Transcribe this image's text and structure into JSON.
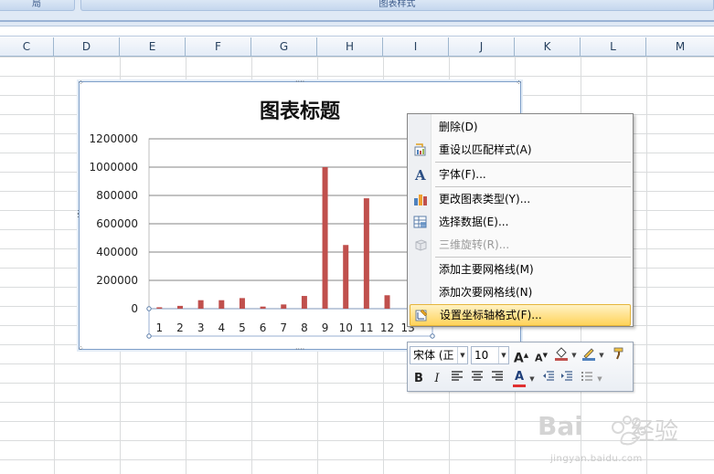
{
  "ribbon": {
    "left_group_label": "局",
    "right_group_label": "图表样式"
  },
  "columns": [
    "C",
    "D",
    "E",
    "F",
    "G",
    "H",
    "I",
    "J",
    "K",
    "L",
    "M"
  ],
  "chart": {
    "title": "图表标题"
  },
  "chart_data": {
    "type": "bar",
    "title": "图表标题",
    "categories": [
      "1",
      "2",
      "3",
      "4",
      "5",
      "6",
      "7",
      "8",
      "9",
      "10",
      "11",
      "12",
      "13"
    ],
    "values": [
      10000,
      20000,
      60000,
      60000,
      75000,
      15000,
      30000,
      90000,
      1000000,
      450000,
      780000,
      95000,
      0
    ],
    "ylim": [
      0,
      1200000
    ],
    "yticks": [
      "0",
      "200000",
      "400000",
      "600000",
      "800000",
      "1000000",
      "1200000"
    ],
    "grid": true,
    "bar_color": "#c0504d"
  },
  "context_menu": {
    "items": [
      {
        "label": "删除(D)",
        "icon": "none",
        "disabled": false
      },
      {
        "label": "重设以匹配样式(A)",
        "icon": "reset-style-icon",
        "disabled": false
      },
      {
        "label": "字体(F)...",
        "icon": "font-icon",
        "disabled": false
      },
      {
        "label": "更改图表类型(Y)...",
        "icon": "change-chart-type-icon",
        "disabled": false
      },
      {
        "label": "选择数据(E)...",
        "icon": "select-data-icon",
        "disabled": false
      },
      {
        "label": "三维旋转(R)...",
        "icon": "3d-rotation-icon",
        "disabled": true
      },
      {
        "label": "添加主要网格线(M)",
        "icon": "none",
        "disabled": false
      },
      {
        "label": "添加次要网格线(N)",
        "icon": "none",
        "disabled": false
      },
      {
        "label": "设置坐标轴格式(F)...",
        "icon": "format-axis-icon",
        "disabled": false
      }
    ]
  },
  "mini_toolbar": {
    "font_name": "宋体 (正",
    "font_size": "10",
    "grow_font": "A",
    "shrink_font": "A",
    "bold": "B",
    "italic": "I",
    "font_color_glyph": "A"
  },
  "watermark": {
    "brand": "Bai",
    "brand_suffix": "经验",
    "url": "jingyan.baidu.com"
  },
  "colors": {
    "bar": "#c0504d",
    "highlight": "#ffd35a",
    "header_bg": "#e4ecf7"
  }
}
